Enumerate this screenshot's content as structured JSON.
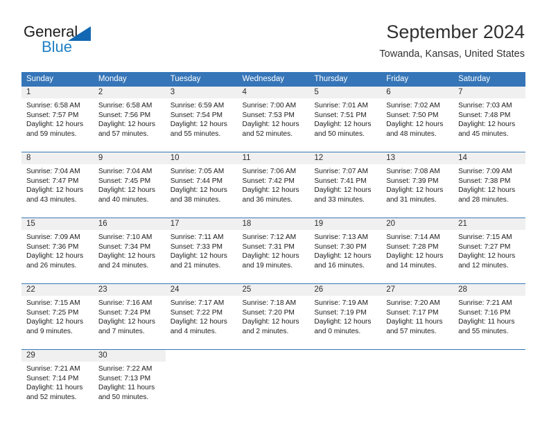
{
  "brand": {
    "name_top": "General",
    "name_bottom": "Blue",
    "color_top": "#1b1b1b",
    "color_bottom": "#1f7ec4",
    "triangle_color": "#1268b3"
  },
  "header": {
    "title": "September 2024",
    "subtitle": "Towanda, Kansas, United States"
  },
  "theme": {
    "header_bg": "#3575b8",
    "header_text": "#ffffff",
    "daynum_bg": "#f0f0f0",
    "week_divider": "#3575b8",
    "page_bg": "#ffffff"
  },
  "calendar": {
    "weekday_headers": [
      "Sunday",
      "Monday",
      "Tuesday",
      "Wednesday",
      "Thursday",
      "Friday",
      "Saturday"
    ],
    "weeks": [
      [
        {
          "day": "1",
          "sunrise": "Sunrise: 6:58 AM",
          "sunset": "Sunset: 7:57 PM",
          "daylight": "Daylight: 12 hours and 59 minutes."
        },
        {
          "day": "2",
          "sunrise": "Sunrise: 6:58 AM",
          "sunset": "Sunset: 7:56 PM",
          "daylight": "Daylight: 12 hours and 57 minutes."
        },
        {
          "day": "3",
          "sunrise": "Sunrise: 6:59 AM",
          "sunset": "Sunset: 7:54 PM",
          "daylight": "Daylight: 12 hours and 55 minutes."
        },
        {
          "day": "4",
          "sunrise": "Sunrise: 7:00 AM",
          "sunset": "Sunset: 7:53 PM",
          "daylight": "Daylight: 12 hours and 52 minutes."
        },
        {
          "day": "5",
          "sunrise": "Sunrise: 7:01 AM",
          "sunset": "Sunset: 7:51 PM",
          "daylight": "Daylight: 12 hours and 50 minutes."
        },
        {
          "day": "6",
          "sunrise": "Sunrise: 7:02 AM",
          "sunset": "Sunset: 7:50 PM",
          "daylight": "Daylight: 12 hours and 48 minutes."
        },
        {
          "day": "7",
          "sunrise": "Sunrise: 7:03 AM",
          "sunset": "Sunset: 7:48 PM",
          "daylight": "Daylight: 12 hours and 45 minutes."
        }
      ],
      [
        {
          "day": "8",
          "sunrise": "Sunrise: 7:04 AM",
          "sunset": "Sunset: 7:47 PM",
          "daylight": "Daylight: 12 hours and 43 minutes."
        },
        {
          "day": "9",
          "sunrise": "Sunrise: 7:04 AM",
          "sunset": "Sunset: 7:45 PM",
          "daylight": "Daylight: 12 hours and 40 minutes."
        },
        {
          "day": "10",
          "sunrise": "Sunrise: 7:05 AM",
          "sunset": "Sunset: 7:44 PM",
          "daylight": "Daylight: 12 hours and 38 minutes."
        },
        {
          "day": "11",
          "sunrise": "Sunrise: 7:06 AM",
          "sunset": "Sunset: 7:42 PM",
          "daylight": "Daylight: 12 hours and 36 minutes."
        },
        {
          "day": "12",
          "sunrise": "Sunrise: 7:07 AM",
          "sunset": "Sunset: 7:41 PM",
          "daylight": "Daylight: 12 hours and 33 minutes."
        },
        {
          "day": "13",
          "sunrise": "Sunrise: 7:08 AM",
          "sunset": "Sunset: 7:39 PM",
          "daylight": "Daylight: 12 hours and 31 minutes."
        },
        {
          "day": "14",
          "sunrise": "Sunrise: 7:09 AM",
          "sunset": "Sunset: 7:38 PM",
          "daylight": "Daylight: 12 hours and 28 minutes."
        }
      ],
      [
        {
          "day": "15",
          "sunrise": "Sunrise: 7:09 AM",
          "sunset": "Sunset: 7:36 PM",
          "daylight": "Daylight: 12 hours and 26 minutes."
        },
        {
          "day": "16",
          "sunrise": "Sunrise: 7:10 AM",
          "sunset": "Sunset: 7:34 PM",
          "daylight": "Daylight: 12 hours and 24 minutes."
        },
        {
          "day": "17",
          "sunrise": "Sunrise: 7:11 AM",
          "sunset": "Sunset: 7:33 PM",
          "daylight": "Daylight: 12 hours and 21 minutes."
        },
        {
          "day": "18",
          "sunrise": "Sunrise: 7:12 AM",
          "sunset": "Sunset: 7:31 PM",
          "daylight": "Daylight: 12 hours and 19 minutes."
        },
        {
          "day": "19",
          "sunrise": "Sunrise: 7:13 AM",
          "sunset": "Sunset: 7:30 PM",
          "daylight": "Daylight: 12 hours and 16 minutes."
        },
        {
          "day": "20",
          "sunrise": "Sunrise: 7:14 AM",
          "sunset": "Sunset: 7:28 PM",
          "daylight": "Daylight: 12 hours and 14 minutes."
        },
        {
          "day": "21",
          "sunrise": "Sunrise: 7:15 AM",
          "sunset": "Sunset: 7:27 PM",
          "daylight": "Daylight: 12 hours and 12 minutes."
        }
      ],
      [
        {
          "day": "22",
          "sunrise": "Sunrise: 7:15 AM",
          "sunset": "Sunset: 7:25 PM",
          "daylight": "Daylight: 12 hours and 9 minutes."
        },
        {
          "day": "23",
          "sunrise": "Sunrise: 7:16 AM",
          "sunset": "Sunset: 7:24 PM",
          "daylight": "Daylight: 12 hours and 7 minutes."
        },
        {
          "day": "24",
          "sunrise": "Sunrise: 7:17 AM",
          "sunset": "Sunset: 7:22 PM",
          "daylight": "Daylight: 12 hours and 4 minutes."
        },
        {
          "day": "25",
          "sunrise": "Sunrise: 7:18 AM",
          "sunset": "Sunset: 7:20 PM",
          "daylight": "Daylight: 12 hours and 2 minutes."
        },
        {
          "day": "26",
          "sunrise": "Sunrise: 7:19 AM",
          "sunset": "Sunset: 7:19 PM",
          "daylight": "Daylight: 12 hours and 0 minutes."
        },
        {
          "day": "27",
          "sunrise": "Sunrise: 7:20 AM",
          "sunset": "Sunset: 7:17 PM",
          "daylight": "Daylight: 11 hours and 57 minutes."
        },
        {
          "day": "28",
          "sunrise": "Sunrise: 7:21 AM",
          "sunset": "Sunset: 7:16 PM",
          "daylight": "Daylight: 11 hours and 55 minutes."
        }
      ],
      [
        {
          "day": "29",
          "sunrise": "Sunrise: 7:21 AM",
          "sunset": "Sunset: 7:14 PM",
          "daylight": "Daylight: 11 hours and 52 minutes."
        },
        {
          "day": "30",
          "sunrise": "Sunrise: 7:22 AM",
          "sunset": "Sunset: 7:13 PM",
          "daylight": "Daylight: 11 hours and 50 minutes."
        },
        {
          "day": "",
          "sunrise": "",
          "sunset": "",
          "daylight": ""
        },
        {
          "day": "",
          "sunrise": "",
          "sunset": "",
          "daylight": ""
        },
        {
          "day": "",
          "sunrise": "",
          "sunset": "",
          "daylight": ""
        },
        {
          "day": "",
          "sunrise": "",
          "sunset": "",
          "daylight": ""
        },
        {
          "day": "",
          "sunrise": "",
          "sunset": "",
          "daylight": ""
        }
      ]
    ]
  }
}
